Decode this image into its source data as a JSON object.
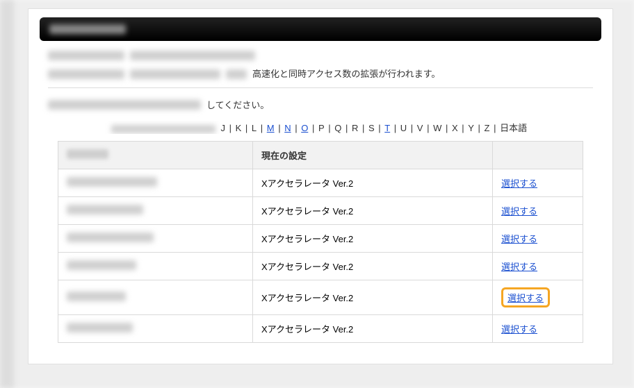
{
  "description_line2_text": "高速化と同時アクセス数の拡張が行われます。",
  "instruction_suffix": "してください。",
  "alpha_nav": {
    "visible": [
      "J",
      "K",
      "L",
      "M",
      "N",
      "O",
      "P",
      "Q",
      "R",
      "S",
      "T",
      "U",
      "V",
      "W",
      "X",
      "Y",
      "Z",
      "日本語"
    ],
    "linked": [
      "M",
      "N",
      "O",
      "T"
    ]
  },
  "table": {
    "headers": {
      "domain": "",
      "current": "現在の設定",
      "action": ""
    },
    "action_label": "選択する",
    "rows": [
      {
        "current": "Xアクセラレータ Ver.2",
        "highlight": false
      },
      {
        "current": "Xアクセラレータ Ver.2",
        "highlight": false
      },
      {
        "current": "Xアクセラレータ Ver.2",
        "highlight": false
      },
      {
        "current": "Xアクセラレータ Ver.2",
        "highlight": false
      },
      {
        "current": "Xアクセラレータ Ver.2",
        "highlight": true
      },
      {
        "current": "Xアクセラレータ Ver.2",
        "highlight": false
      }
    ]
  }
}
